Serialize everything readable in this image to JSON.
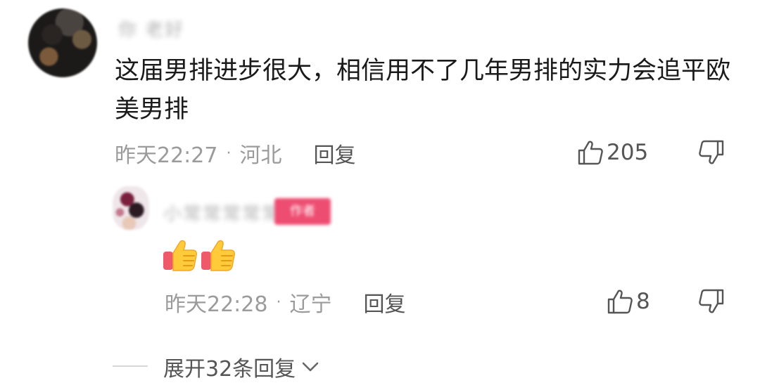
{
  "comment": {
    "author": "你 老好",
    "text": "这届男排进步很大，相信用不了几年男排的实力会追平欧美男排",
    "time": "昨天22:27",
    "location": "河北",
    "reply_label": "回复",
    "likes": "205",
    "like_icon": "thumbs-up-outline-icon",
    "dislike_icon": "thumbs-down-outline-icon"
  },
  "reply": {
    "author": "小常常常常常",
    "badge": "作者",
    "emoji": [
      "thumbs-up-emoji",
      "thumbs-up-emoji"
    ],
    "time": "昨天22:28",
    "location": "辽宁",
    "reply_label": "回复",
    "likes": "8"
  },
  "expand": {
    "label": "展开32条回复",
    "icon": "chevron-down-icon"
  },
  "colors": {
    "meta_gray": "#9b9b9b",
    "text_dark": "#1a1a1a",
    "badge_pink": "#ee4d72"
  }
}
